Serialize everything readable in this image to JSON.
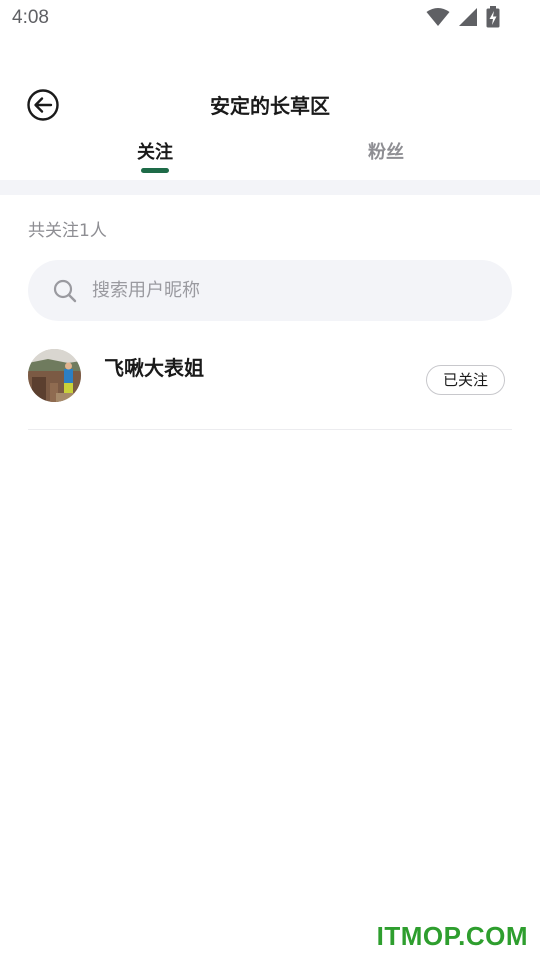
{
  "status_bar": {
    "time": "4:08",
    "icons": [
      "wifi-icon",
      "cellular-signal-icon",
      "battery-charging-icon"
    ]
  },
  "header": {
    "back_icon": "back-arrow-icon",
    "title": "安定的长草区"
  },
  "tabs": [
    {
      "label": "关注",
      "active": true
    },
    {
      "label": "粉丝",
      "active": false
    }
  ],
  "accent_color": "#1e6b48",
  "summary": {
    "count_text": "共关注1人"
  },
  "search": {
    "icon": "search-icon",
    "placeholder": "搜索用户昵称",
    "value": ""
  },
  "users": [
    {
      "name": "飞啾大表姐",
      "follow_label": "已关注",
      "avatar": "avatar-photo"
    }
  ],
  "watermark": "ITMOP.COM"
}
